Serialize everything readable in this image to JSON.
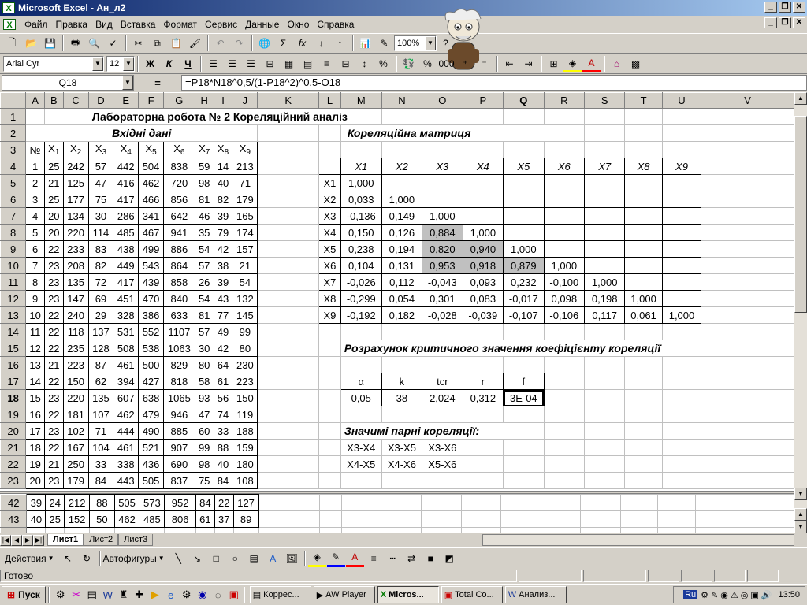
{
  "window": {
    "title": "Microsoft Excel - Ан_л2"
  },
  "menu": [
    "Файл",
    "Правка",
    "Вид",
    "Вставка",
    "Формат",
    "Сервис",
    "Данные",
    "Окно",
    "Справка"
  ],
  "toolbar": {
    "zoom": "100%"
  },
  "format": {
    "font": "Arial Cyr",
    "size": "12",
    "bold": "Ж",
    "italic": "К",
    "underline": "Ч"
  },
  "formula_bar": {
    "name_box": "Q18",
    "equals": "=",
    "formula": "=P18*N18^0,5/(1-P18^2)^0,5-O18"
  },
  "columns": [
    "A",
    "B",
    "C",
    "D",
    "E",
    "F",
    "G",
    "H",
    "I",
    "J",
    "K",
    "L",
    "M",
    "N",
    "O",
    "P",
    "Q",
    "R",
    "S",
    "T",
    "U",
    "V"
  ],
  "sheet": {
    "title": "Лабораторна робота № 2 Кореляційний аналіз",
    "input_title": "Вхідні дані",
    "matrix_title": "Кореляційна матриця",
    "critical_title": "Розрахунок критичного значення коефіцієнту кореляції",
    "significant_title": "Значимі парні кореляції:",
    "num_header": "№",
    "x_headers": [
      "X",
      "X",
      "X",
      "X",
      "X",
      "X",
      "X",
      "X",
      "X"
    ],
    "x_subs": [
      "1",
      "2",
      "3",
      "4",
      "5",
      "6",
      "7",
      "8",
      "9"
    ],
    "data_rows": [
      {
        "r": "4",
        "v": [
          "1",
          "25",
          "242",
          "57",
          "442",
          "504",
          "838",
          "59",
          "14",
          "213"
        ]
      },
      {
        "r": "5",
        "v": [
          "2",
          "21",
          "125",
          "47",
          "416",
          "462",
          "720",
          "98",
          "40",
          "71"
        ]
      },
      {
        "r": "6",
        "v": [
          "3",
          "25",
          "177",
          "75",
          "417",
          "466",
          "856",
          "81",
          "82",
          "179"
        ]
      },
      {
        "r": "7",
        "v": [
          "4",
          "20",
          "134",
          "30",
          "286",
          "341",
          "642",
          "46",
          "39",
          "165"
        ]
      },
      {
        "r": "8",
        "v": [
          "5",
          "20",
          "220",
          "114",
          "485",
          "467",
          "941",
          "35",
          "79",
          "174"
        ]
      },
      {
        "r": "9",
        "v": [
          "6",
          "22",
          "233",
          "83",
          "438",
          "499",
          "886",
          "54",
          "42",
          "157"
        ]
      },
      {
        "r": "10",
        "v": [
          "7",
          "23",
          "208",
          "82",
          "449",
          "543",
          "864",
          "57",
          "38",
          "21"
        ]
      },
      {
        "r": "11",
        "v": [
          "8",
          "23",
          "135",
          "72",
          "417",
          "439",
          "858",
          "26",
          "39",
          "54"
        ]
      },
      {
        "r": "12",
        "v": [
          "9",
          "23",
          "147",
          "69",
          "451",
          "470",
          "840",
          "54",
          "43",
          "132"
        ]
      },
      {
        "r": "13",
        "v": [
          "10",
          "22",
          "240",
          "29",
          "328",
          "386",
          "633",
          "81",
          "77",
          "145"
        ]
      },
      {
        "r": "14",
        "v": [
          "11",
          "22",
          "118",
          "137",
          "531",
          "552",
          "1107",
          "57",
          "49",
          "99"
        ]
      },
      {
        "r": "15",
        "v": [
          "12",
          "22",
          "235",
          "128",
          "508",
          "538",
          "1063",
          "30",
          "42",
          "80"
        ]
      },
      {
        "r": "16",
        "v": [
          "13",
          "21",
          "223",
          "87",
          "461",
          "500",
          "829",
          "80",
          "64",
          "230"
        ]
      },
      {
        "r": "17",
        "v": [
          "14",
          "22",
          "150",
          "62",
          "394",
          "427",
          "818",
          "58",
          "61",
          "223"
        ]
      },
      {
        "r": "18",
        "v": [
          "15",
          "23",
          "220",
          "135",
          "607",
          "638",
          "1065",
          "93",
          "56",
          "150"
        ]
      },
      {
        "r": "19",
        "v": [
          "16",
          "22",
          "181",
          "107",
          "462",
          "479",
          "946",
          "47",
          "74",
          "119"
        ]
      },
      {
        "r": "20",
        "v": [
          "17",
          "23",
          "102",
          "71",
          "444",
          "490",
          "885",
          "60",
          "33",
          "188"
        ]
      },
      {
        "r": "21",
        "v": [
          "18",
          "22",
          "167",
          "104",
          "461",
          "521",
          "907",
          "99",
          "88",
          "159"
        ]
      },
      {
        "r": "22",
        "v": [
          "19",
          "21",
          "250",
          "33",
          "338",
          "436",
          "690",
          "98",
          "40",
          "180"
        ]
      },
      {
        "r": "23",
        "v": [
          "20",
          "23",
          "179",
          "84",
          "443",
          "505",
          "837",
          "75",
          "84",
          "108"
        ]
      }
    ],
    "tail_rows": [
      {
        "r": "42",
        "v": [
          "39",
          "24",
          "212",
          "88",
          "505",
          "573",
          "952",
          "84",
          "22",
          "127"
        ]
      },
      {
        "r": "43",
        "v": [
          "40",
          "25",
          "152",
          "50",
          "462",
          "485",
          "806",
          "61",
          "37",
          "89"
        ]
      },
      {
        "r": "44",
        "v": [
          "",
          "",
          "",
          "",
          "",
          "",
          "",
          "",
          "",
          ""
        ]
      }
    ],
    "matrix_cols": [
      "X1",
      "X2",
      "X3",
      "X4",
      "X5",
      "X6",
      "X7",
      "X8",
      "X9"
    ],
    "matrix_rows": [
      {
        "label": "X1",
        "v": [
          "1,000",
          "",
          "",
          "",
          "",
          "",
          "",
          "",
          ""
        ]
      },
      {
        "label": "X2",
        "v": [
          "0,033",
          "1,000",
          "",
          "",
          "",
          "",
          "",
          "",
          ""
        ]
      },
      {
        "label": "X3",
        "v": [
          "-0,136",
          "0,149",
          "1,000",
          "",
          "",
          "",
          "",
          "",
          ""
        ]
      },
      {
        "label": "X4",
        "v": [
          "0,150",
          "0,126",
          "0,884",
          "1,000",
          "",
          "",
          "",
          "",
          ""
        ]
      },
      {
        "label": "X5",
        "v": [
          "0,238",
          "0,194",
          "0,820",
          "0,940",
          "1,000",
          "",
          "",
          "",
          ""
        ]
      },
      {
        "label": "X6",
        "v": [
          "0,104",
          "0,131",
          "0,953",
          "0,918",
          "0,879",
          "1,000",
          "",
          "",
          ""
        ]
      },
      {
        "label": "X7",
        "v": [
          "-0,026",
          "0,112",
          "-0,043",
          "0,093",
          "0,232",
          "-0,100",
          "1,000",
          "",
          ""
        ]
      },
      {
        "label": "X8",
        "v": [
          "-0,299",
          "0,054",
          "0,301",
          "0,083",
          "-0,017",
          "0,098",
          "0,198",
          "1,000",
          ""
        ]
      },
      {
        "label": "X9",
        "v": [
          "-0,192",
          "0,182",
          "-0,028",
          "-0,039",
          "-0,107",
          "-0,106",
          "0,117",
          "0,061",
          "1,000"
        ]
      }
    ],
    "critical_headers": [
      "α",
      "k",
      "tcr",
      "r",
      "f"
    ],
    "critical_values": [
      "0,05",
      "38",
      "2,024",
      "0,312",
      "3E-04"
    ],
    "significant_row1": [
      "X3-X4",
      "X3-X5",
      "X3-X6"
    ],
    "significant_row2": [
      "X4-X5",
      "X4-X6",
      "X5-X6"
    ]
  },
  "tabs": [
    "Лист1",
    "Лист2",
    "Лист3"
  ],
  "drawing": {
    "actions": "Действия",
    "autoshapes": "Автофигуры"
  },
  "status": {
    "text": "Готово"
  },
  "taskbar": {
    "start": "Пуск",
    "tasks": [
      "Коррес...",
      "AW Player",
      "Micros...",
      "Total Co...",
      "Анализ..."
    ],
    "clock": "13:50",
    "lang": "Ru"
  }
}
